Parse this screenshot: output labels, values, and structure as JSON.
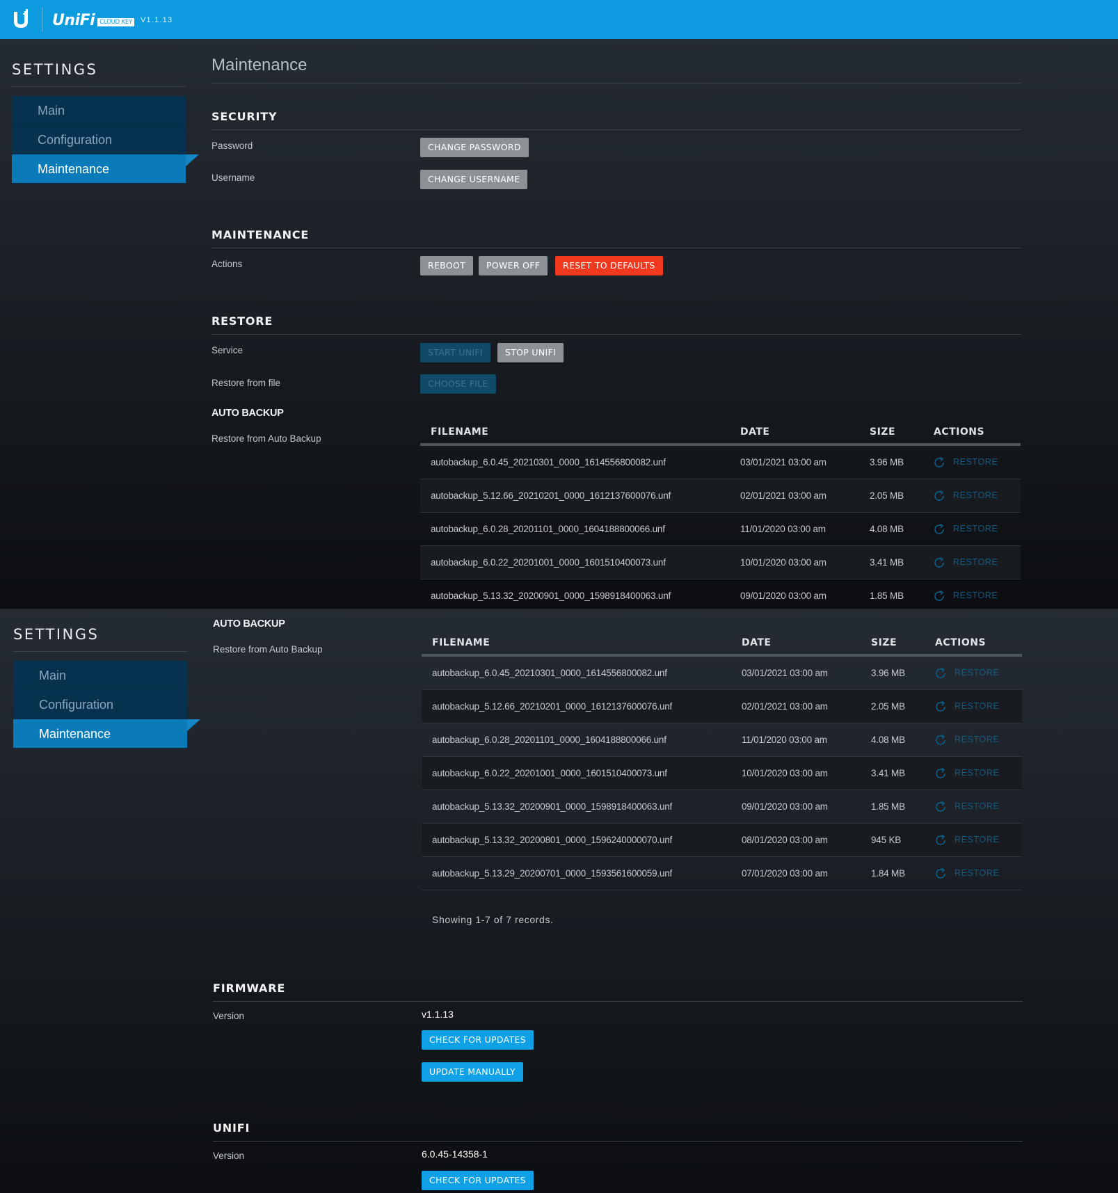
{
  "header": {
    "brand_name": "UniFi",
    "brand_badge": "CLOUD KEY",
    "version": "V1.1.13",
    "logo_icon": "ubiquiti-u-logo"
  },
  "sidebar": {
    "title": "SETTINGS",
    "items": [
      {
        "label": "Main",
        "active": false
      },
      {
        "label": "Configuration",
        "active": false
      },
      {
        "label": "Maintenance",
        "active": true
      }
    ]
  },
  "page": {
    "title": "Maintenance"
  },
  "security": {
    "heading": "SECURITY",
    "password_label": "Password",
    "change_password": "CHANGE PASSWORD",
    "username_label": "Username",
    "change_username": "CHANGE USERNAME"
  },
  "maintenance": {
    "heading": "MAINTENANCE",
    "actions_label": "Actions",
    "reboot": "REBOOT",
    "power_off": "POWER OFF",
    "reset": "RESET TO DEFAULTS"
  },
  "restore": {
    "heading": "RESTORE",
    "service_label": "Service",
    "start_unifi": "START UNIFI",
    "stop_unifi": "STOP UNIFI",
    "restore_file_label": "Restore from file",
    "choose_file": "CHOOSE FILE"
  },
  "auto_backup": {
    "heading": "AUTO BACKUP",
    "label": "Restore from Auto Backup",
    "columns": {
      "filename": "FILENAME",
      "date": "DATE",
      "size": "SIZE",
      "actions": "ACTIONS"
    },
    "restore_label": "RESTORE",
    "restore_icon": "refresh-icon",
    "rows": [
      {
        "filename": "autobackup_6.0.45_20210301_0000_1614556800082.unf",
        "date": "03/01/2021 03:00 am",
        "size": "3.96 MB"
      },
      {
        "filename": "autobackup_5.12.66_20210201_0000_1612137600076.unf",
        "date": "02/01/2021 03:00 am",
        "size": "2.05 MB"
      },
      {
        "filename": "autobackup_6.0.28_20201101_0000_1604188800066.unf",
        "date": "11/01/2020 03:00 am",
        "size": "4.08 MB"
      },
      {
        "filename": "autobackup_6.0.22_20201001_0000_1601510400073.unf",
        "date": "10/01/2020 03:00 am",
        "size": "3.41 MB"
      },
      {
        "filename": "autobackup_5.13.32_20200901_0000_1598918400063.unf",
        "date": "09/01/2020 03:00 am",
        "size": "1.85 MB"
      },
      {
        "filename": "autobackup_5.13.32_20200801_0000_1596240000070.unf",
        "date": "08/01/2020 03:00 am",
        "size": "945 KB"
      },
      {
        "filename": "autobackup_5.13.29_20200701_0000_1593561600059.unf",
        "date": "07/01/2020 03:00 am",
        "size": "1.84 MB"
      }
    ],
    "records_text": "Showing 1-7 of 7 records."
  },
  "firmware": {
    "heading": "FIRMWARE",
    "version_label": "Version",
    "version": "v1.1.13",
    "check_updates": "CHECK FOR UPDATES",
    "update_manually": "UPDATE MANUALLY"
  },
  "unifi": {
    "heading": "UNIFI",
    "version_label": "Version",
    "version": "6.0.45-14358-1",
    "check_updates": "CHECK FOR UPDATES"
  },
  "colors": {
    "header": "#0d9be0",
    "nav_active": "#0b7ab8",
    "danger": "#f0391f",
    "primary": "#10a0e6"
  }
}
